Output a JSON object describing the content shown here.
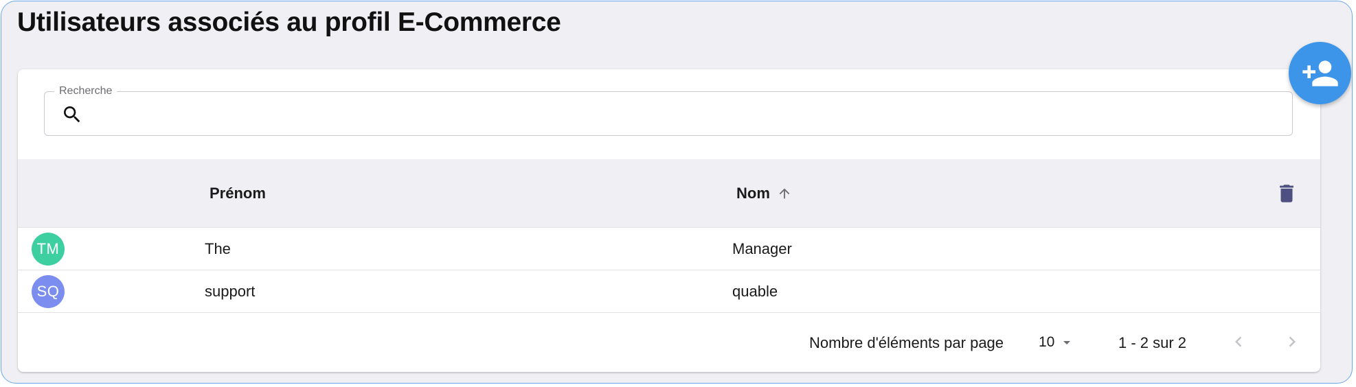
{
  "page": {
    "title": "Utilisateurs associés au profil E-Commerce"
  },
  "search": {
    "label": "Recherche",
    "value": "",
    "icon": "search-icon"
  },
  "table": {
    "columns": {
      "prenom": "Prénom",
      "nom": "Nom",
      "sort": "ascending"
    },
    "rows": [
      {
        "initials": "TM",
        "prenom": "The",
        "nom": "Manager",
        "avatar_color": "#3ecfa1"
      },
      {
        "initials": "SQ",
        "prenom": "support",
        "nom": "quable",
        "avatar_color": "#7b8ef0"
      }
    ]
  },
  "pagination": {
    "rows_per_page_label": "Nombre d'éléments par page",
    "rows_per_page_value": "10",
    "range_label": "1 - 2 sur 2"
  },
  "colors": {
    "accent": "#3d95ea",
    "delete_icon": "#4d5080",
    "frame_border": "#6aa6e8",
    "background": "#f0f0f4"
  },
  "icons": {
    "add_user": "add-user-icon",
    "delete": "trash-icon",
    "sort": "arrow-up-icon",
    "prev": "chevron-left-icon",
    "next": "chevron-right-icon",
    "caret": "caret-down-icon"
  }
}
